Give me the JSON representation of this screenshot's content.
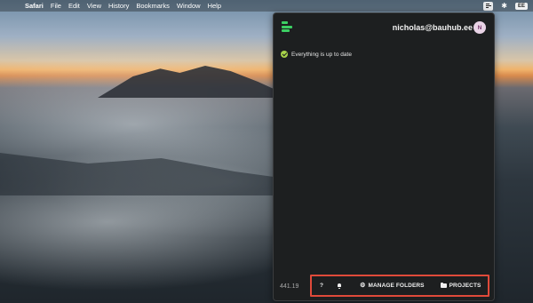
{
  "menubar": {
    "apple_icon": "apple-logo-icon",
    "app_name": "Safari",
    "menus": [
      "File",
      "Edit",
      "View",
      "History",
      "Bookmarks",
      "Window",
      "Help"
    ],
    "tray_icons": [
      "bauhub-tray-icon",
      "bluetooth-icon"
    ],
    "input_badge": "EE"
  },
  "panel": {
    "logo_icon": "bauhub-logo-icon",
    "user_email": "nicholas@bauhub.ee",
    "avatar_initial": "N",
    "status_text": "Everything is up to date",
    "version": "441.19",
    "footer": {
      "help_label": "?",
      "notifications_icon": "bell-icon",
      "manage_folders_label": "MANAGE FOLDERS",
      "projects_label": "PROJECTS"
    },
    "highlight_color": "#e04a3a",
    "accent_color": "#3ccf63"
  }
}
